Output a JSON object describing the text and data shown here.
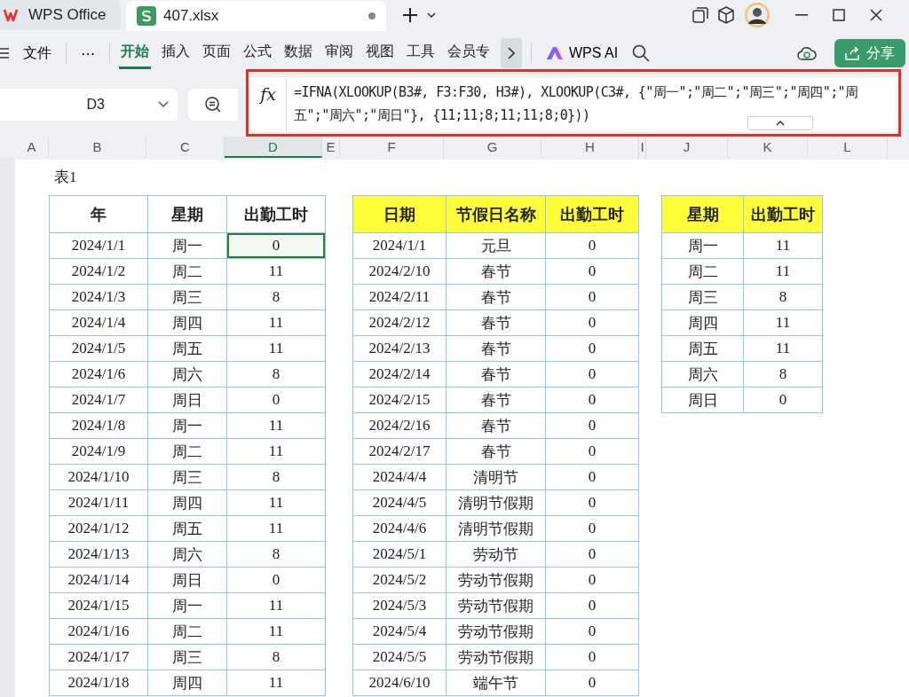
{
  "title_tabs": [
    {
      "label": "WPS Office",
      "kind": "home",
      "selected": false
    },
    {
      "label": "407.xlsx",
      "kind": "sheet",
      "selected": true
    }
  ],
  "ribbon": {
    "file_menu": "文件",
    "more": "⋯",
    "tabs": [
      {
        "label": "开始",
        "selected": true
      },
      {
        "label": "插入",
        "selected": false
      },
      {
        "label": "页面",
        "selected": false
      },
      {
        "label": "公式",
        "selected": false
      },
      {
        "label": "数据",
        "selected": false
      },
      {
        "label": "审阅",
        "selected": false
      },
      {
        "label": "视图",
        "selected": false
      },
      {
        "label": "工具",
        "selected": false
      },
      {
        "label": "会员专",
        "selected": false
      }
    ],
    "ai": "WPS AI",
    "share": "分享"
  },
  "formula_bar": {
    "name_box": "D3",
    "fx": "fx",
    "formula": "=IFNA(XLOOKUP(B3#, F3:F30, H3#), XLOOKUP(C3#, {\"周一\";\"周二\";\"周三\";\"周四\";\"周五\";\"周六\";\"周日\"}, {11;11;8;11;11;8;0}))"
  },
  "column_headers": [
    {
      "label": "A",
      "selected": false
    },
    {
      "label": "B",
      "selected": false
    },
    {
      "label": "C",
      "selected": false
    },
    {
      "label": "D",
      "selected": true
    },
    {
      "label": "E",
      "selected": false
    },
    {
      "label": "F",
      "selected": false
    },
    {
      "label": "G",
      "selected": false
    },
    {
      "label": "H",
      "selected": false
    },
    {
      "label": "I",
      "selected": false
    },
    {
      "label": "J",
      "selected": false
    },
    {
      "label": "K",
      "selected": false
    },
    {
      "label": "L",
      "selected": false
    }
  ],
  "sheet": {
    "caption": "表1",
    "tables": [
      {
        "highlighted": false,
        "columns": [
          "年",
          "星期",
          "出勤工时"
        ],
        "rows": [
          [
            {
              "text": "2024/1/1",
              "selected": false
            },
            {
              "text": "周一",
              "selected": false
            },
            {
              "text": "0",
              "selected": true
            }
          ],
          [
            {
              "text": "2024/1/2",
              "selected": false
            },
            {
              "text": "周二",
              "selected": false
            },
            {
              "text": "11",
              "selected": false
            }
          ],
          [
            {
              "text": "2024/1/3",
              "selected": false
            },
            {
              "text": "周三",
              "selected": false
            },
            {
              "text": "8",
              "selected": false
            }
          ],
          [
            {
              "text": "2024/1/4",
              "selected": false
            },
            {
              "text": "周四",
              "selected": false
            },
            {
              "text": "11",
              "selected": false
            }
          ],
          [
            {
              "text": "2024/1/5",
              "selected": false
            },
            {
              "text": "周五",
              "selected": false
            },
            {
              "text": "11",
              "selected": false
            }
          ],
          [
            {
              "text": "2024/1/6",
              "selected": false
            },
            {
              "text": "周六",
              "selected": false
            },
            {
              "text": "8",
              "selected": false
            }
          ],
          [
            {
              "text": "2024/1/7",
              "selected": false
            },
            {
              "text": "周日",
              "selected": false
            },
            {
              "text": "0",
              "selected": false
            }
          ],
          [
            {
              "text": "2024/1/8",
              "selected": false
            },
            {
              "text": "周一",
              "selected": false
            },
            {
              "text": "11",
              "selected": false
            }
          ],
          [
            {
              "text": "2024/1/9",
              "selected": false
            },
            {
              "text": "周二",
              "selected": false
            },
            {
              "text": "11",
              "selected": false
            }
          ],
          [
            {
              "text": "2024/1/10",
              "selected": false
            },
            {
              "text": "周三",
              "selected": false
            },
            {
              "text": "8",
              "selected": false
            }
          ],
          [
            {
              "text": "2024/1/11",
              "selected": false
            },
            {
              "text": "周四",
              "selected": false
            },
            {
              "text": "11",
              "selected": false
            }
          ],
          [
            {
              "text": "2024/1/12",
              "selected": false
            },
            {
              "text": "周五",
              "selected": false
            },
            {
              "text": "11",
              "selected": false
            }
          ],
          [
            {
              "text": "2024/1/13",
              "selected": false
            },
            {
              "text": "周六",
              "selected": false
            },
            {
              "text": "8",
              "selected": false
            }
          ],
          [
            {
              "text": "2024/1/14",
              "selected": false
            },
            {
              "text": "周日",
              "selected": false
            },
            {
              "text": "0",
              "selected": false
            }
          ],
          [
            {
              "text": "2024/1/15",
              "selected": false
            },
            {
              "text": "周一",
              "selected": false
            },
            {
              "text": "11",
              "selected": false
            }
          ],
          [
            {
              "text": "2024/1/16",
              "selected": false
            },
            {
              "text": "周二",
              "selected": false
            },
            {
              "text": "11",
              "selected": false
            }
          ],
          [
            {
              "text": "2024/1/17",
              "selected": false
            },
            {
              "text": "周三",
              "selected": false
            },
            {
              "text": "8",
              "selected": false
            }
          ],
          [
            {
              "text": "2024/1/18",
              "selected": false
            },
            {
              "text": "周四",
              "selected": false
            },
            {
              "text": "11",
              "selected": false
            }
          ]
        ]
      },
      {
        "highlighted": true,
        "columns": [
          "日期",
          "节假日名称",
          "出勤工时"
        ],
        "rows": [
          [
            {
              "text": "2024/1/1",
              "selected": false
            },
            {
              "text": "元旦",
              "selected": false
            },
            {
              "text": "0",
              "selected": false
            }
          ],
          [
            {
              "text": "2024/2/10",
              "selected": false
            },
            {
              "text": "春节",
              "selected": false
            },
            {
              "text": "0",
              "selected": false
            }
          ],
          [
            {
              "text": "2024/2/11",
              "selected": false
            },
            {
              "text": "春节",
              "selected": false
            },
            {
              "text": "0",
              "selected": false
            }
          ],
          [
            {
              "text": "2024/2/12",
              "selected": false
            },
            {
              "text": "春节",
              "selected": false
            },
            {
              "text": "0",
              "selected": false
            }
          ],
          [
            {
              "text": "2024/2/13",
              "selected": false
            },
            {
              "text": "春节",
              "selected": false
            },
            {
              "text": "0",
              "selected": false
            }
          ],
          [
            {
              "text": "2024/2/14",
              "selected": false
            },
            {
              "text": "春节",
              "selected": false
            },
            {
              "text": "0",
              "selected": false
            }
          ],
          [
            {
              "text": "2024/2/15",
              "selected": false
            },
            {
              "text": "春节",
              "selected": false
            },
            {
              "text": "0",
              "selected": false
            }
          ],
          [
            {
              "text": "2024/2/16",
              "selected": false
            },
            {
              "text": "春节",
              "selected": false
            },
            {
              "text": "0",
              "selected": false
            }
          ],
          [
            {
              "text": "2024/2/17",
              "selected": false
            },
            {
              "text": "春节",
              "selected": false
            },
            {
              "text": "0",
              "selected": false
            }
          ],
          [
            {
              "text": "2024/4/4",
              "selected": false
            },
            {
              "text": "清明节",
              "selected": false
            },
            {
              "text": "0",
              "selected": false
            }
          ],
          [
            {
              "text": "2024/4/5",
              "selected": false
            },
            {
              "text": "清明节假期",
              "selected": false
            },
            {
              "text": "0",
              "selected": false
            }
          ],
          [
            {
              "text": "2024/4/6",
              "selected": false
            },
            {
              "text": "清明节假期",
              "selected": false
            },
            {
              "text": "0",
              "selected": false
            }
          ],
          [
            {
              "text": "2024/5/1",
              "selected": false
            },
            {
              "text": "劳动节",
              "selected": false
            },
            {
              "text": "0",
              "selected": false
            }
          ],
          [
            {
              "text": "2024/5/2",
              "selected": false
            },
            {
              "text": "劳动节假期",
              "selected": false
            },
            {
              "text": "0",
              "selected": false
            }
          ],
          [
            {
              "text": "2024/5/3",
              "selected": false
            },
            {
              "text": "劳动节假期",
              "selected": false
            },
            {
              "text": "0",
              "selected": false
            }
          ],
          [
            {
              "text": "2024/5/4",
              "selected": false
            },
            {
              "text": "劳动节假期",
              "selected": false
            },
            {
              "text": "0",
              "selected": false
            }
          ],
          [
            {
              "text": "2024/5/5",
              "selected": false
            },
            {
              "text": "劳动节假期",
              "selected": false
            },
            {
              "text": "0",
              "selected": false
            }
          ],
          [
            {
              "text": "2024/6/10",
              "selected": false
            },
            {
              "text": "端午节",
              "selected": false
            },
            {
              "text": "0",
              "selected": false
            }
          ]
        ]
      },
      {
        "highlighted": true,
        "columns": [
          "星期",
          "出勤工时"
        ],
        "rows": [
          [
            {
              "text": "周一",
              "selected": false
            },
            {
              "text": "11",
              "selected": false
            }
          ],
          [
            {
              "text": "周二",
              "selected": false
            },
            {
              "text": "11",
              "selected": false
            }
          ],
          [
            {
              "text": "周三",
              "selected": false
            },
            {
              "text": "8",
              "selected": false
            }
          ],
          [
            {
              "text": "周四",
              "selected": false
            },
            {
              "text": "11",
              "selected": false
            }
          ],
          [
            {
              "text": "周五",
              "selected": false
            },
            {
              "text": "11",
              "selected": false
            }
          ],
          [
            {
              "text": "周六",
              "selected": false
            },
            {
              "text": "8",
              "selected": false
            }
          ],
          [
            {
              "text": "周日",
              "selected": false
            },
            {
              "text": "0",
              "selected": false
            }
          ]
        ]
      }
    ]
  }
}
